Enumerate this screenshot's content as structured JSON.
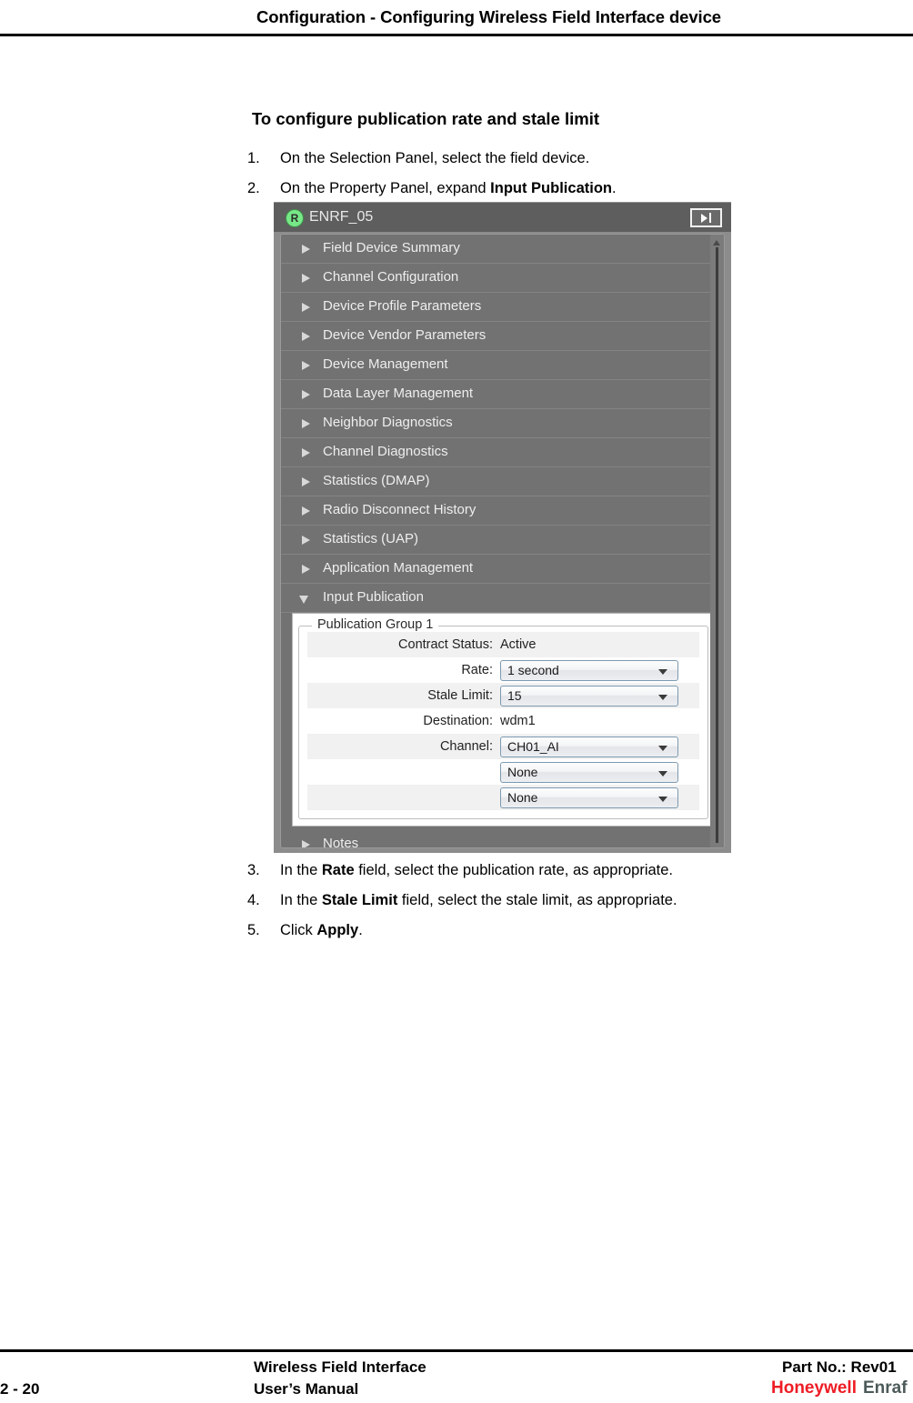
{
  "page": {
    "header_title": "Configuration - Configuring Wireless Field Interface device",
    "section_title": "To configure publication rate and stale limit"
  },
  "steps": [
    {
      "num": "1.",
      "pre": "On the Selection Panel, select the field device.",
      "bold": "",
      "post": ""
    },
    {
      "num": "2.",
      "pre": "On the Property Panel, expand ",
      "bold": "Input Publication",
      "post": "."
    },
    {
      "num": "3.",
      "pre": "In the ",
      "bold": "Rate",
      "post": " field, select the publication rate, as appropriate."
    },
    {
      "num": "4.",
      "pre": "In the ",
      "bold": "Stale Limit",
      "post": " field, select the stale limit, as appropriate."
    },
    {
      "num": "5.",
      "pre": "Click ",
      "bold": "Apply",
      "post": "."
    }
  ],
  "app": {
    "titlebar": {
      "badge": "R",
      "device_name": "ENRF_05",
      "next_button_name": "next-panel-button"
    },
    "tree_items": [
      {
        "label": "Field Device Summary",
        "expanded": false
      },
      {
        "label": "Channel Configuration",
        "expanded": false
      },
      {
        "label": "Device Profile Parameters",
        "expanded": false
      },
      {
        "label": "Device Vendor Parameters",
        "expanded": false
      },
      {
        "label": "Device Management",
        "expanded": false
      },
      {
        "label": "Data Layer Management",
        "expanded": false
      },
      {
        "label": "Neighbor Diagnostics",
        "expanded": false
      },
      {
        "label": "Channel Diagnostics",
        "expanded": false
      },
      {
        "label": "Statistics (DMAP)",
        "expanded": false
      },
      {
        "label": "Radio Disconnect History",
        "expanded": false
      },
      {
        "label": "Statistics (UAP)",
        "expanded": false
      },
      {
        "label": "Application Management",
        "expanded": false
      },
      {
        "label": "Input Publication",
        "expanded": true
      }
    ],
    "publication_group": {
      "legend": "Publication Group 1",
      "rows": [
        {
          "label": "Contract Status:",
          "type": "text",
          "value": "Active"
        },
        {
          "label": "Rate:",
          "type": "combo",
          "value": "1 second"
        },
        {
          "label": "Stale Limit:",
          "type": "combo",
          "value": "15"
        },
        {
          "label": "Destination:",
          "type": "text",
          "value": "wdm1"
        },
        {
          "label": "Channel:",
          "type": "combo",
          "value": "CH01_AI"
        },
        {
          "label": "",
          "type": "combo",
          "value": "None"
        },
        {
          "label": "",
          "type": "combo",
          "value": "None"
        }
      ]
    },
    "notes_item": {
      "label": "Notes",
      "expanded": false
    }
  },
  "footer": {
    "product": "Wireless Field Interface",
    "manual": "User’s Manual",
    "page_number": "2 - 20",
    "part_no": "Part No.: Rev01",
    "logo_primary": "Honeywell",
    "logo_secondary": "Enraf"
  },
  "colors": {
    "brand_red": "#EE1C25",
    "brand_gray": "#4d5a5a",
    "panel_gray": "#727272",
    "titlebar_gray": "#5e5e5e",
    "status_green": "#77e887"
  }
}
